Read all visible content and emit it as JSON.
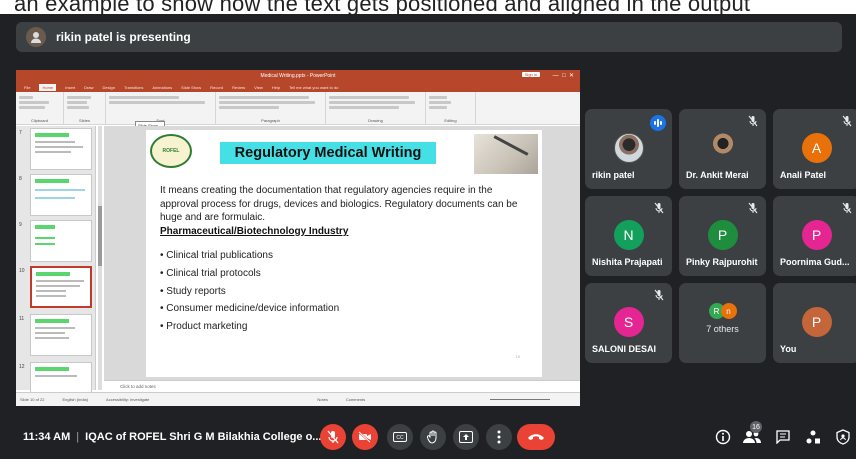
{
  "caption": {
    "text": "an example to show how the text gets positioned and aligned in the output"
  },
  "presenting": {
    "label": "rikin patel is presenting"
  },
  "powerpoint": {
    "window_title": "Medical Writing.pptx  -  PowerPoint",
    "signin": "Sign in",
    "tabs": [
      "File",
      "Home",
      "Insert",
      "Draw",
      "Design",
      "Transitions",
      "Animations",
      "Slide Show",
      "Record",
      "Review",
      "View",
      "Help",
      "Tell me what you want to do"
    ],
    "ribbon_groups": [
      "Clipboard",
      "Slides",
      "Font",
      "Paragraph",
      "Drawing",
      "Editing"
    ],
    "tooltip": [
      "Slide Show",
      "Reuse Slides"
    ],
    "thumbnail_numbers": [
      "7",
      "8",
      "9",
      "10",
      "11",
      "12"
    ],
    "slide": {
      "logo_text": "ROFEL",
      "title": "Regulatory Medical Writing",
      "body": "It means creating the documentation that regulatory agencies require in the approval process for drugs, devices and biologics. Regulatory documents can be huge and are formulaic.",
      "subheading": "Pharmaceutical/Biotechnology Industry",
      "bullets": [
        "Clinical trial publications",
        "Clinical trial protocols",
        "Study reports",
        "Consumer medicine/device information",
        "Product marketing"
      ],
      "page_num": "10"
    },
    "notes_placeholder": "Click to add notes",
    "status": {
      "slide_count": "Slide 10 of 22",
      "language": "English (India)",
      "accessibility": "Accessibility: Investigate",
      "notes": "Notes",
      "comments": "Comments"
    }
  },
  "participants": [
    {
      "name": "rikin patel",
      "initial": "",
      "color": "#cfd8dc",
      "speaking": true,
      "photo": true
    },
    {
      "name": "Dr. Ankit Merai",
      "initial": "",
      "color": "#3c4043",
      "muted": true,
      "photo": true
    },
    {
      "name": "Anali Patel",
      "initial": "A",
      "color": "#e8710a",
      "muted": true
    },
    {
      "name": "Nishita Prajapati",
      "initial": "N",
      "color": "#12a05c",
      "muted": true
    },
    {
      "name": "Pinky Rajpurohit",
      "initial": "P",
      "color": "#1e8e3e",
      "muted": true
    },
    {
      "name": "Poornima Gud...",
      "initial": "P",
      "color": "#e52592",
      "muted": true
    },
    {
      "name": "SALONI DESAI",
      "initial": "S",
      "color": "#e52592",
      "muted": true
    },
    {
      "name": "7 others",
      "initial": "",
      "color": "#3c4043",
      "others": [
        "R",
        "n"
      ],
      "others_colors": [
        "#34a853",
        "#e8710a"
      ]
    },
    {
      "name": "You",
      "initial": "P",
      "color": "#c5653a",
      "muted": true
    }
  ],
  "bottom": {
    "time": "11:34 AM",
    "meeting_name": "IQAC of ROFEL Shri G M Bilakhia College o...",
    "participant_count": "16"
  },
  "colors": {
    "background": "#202124",
    "tile": "#3c4043",
    "red": "#ea4335",
    "accent_blue": "#1a73e8",
    "ppt_brand": "#b7472a"
  },
  "icons": {
    "mic_off": "mic-off-icon",
    "cam_off": "camera-off-icon",
    "captions": "captions-icon",
    "raise_hand": "raise-hand-icon",
    "present": "present-icon",
    "more": "more-options-icon",
    "end_call": "end-call-icon",
    "info": "info-icon",
    "people": "people-icon",
    "chat": "chat-icon",
    "activities": "activities-icon",
    "host_controls": "host-controls-icon"
  }
}
